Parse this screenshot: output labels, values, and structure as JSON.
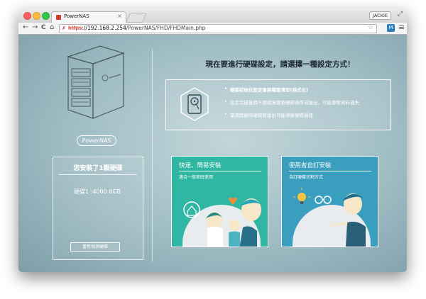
{
  "browser": {
    "tab_title": "PowerNAS",
    "tab_close": "×",
    "user_badge": "JACKIE",
    "url_protocol": "https",
    "url_host": "://192.168.2.254",
    "url_path": "/PowerNAS/FHD/FHDMain.php",
    "nav_back": "←",
    "nav_forward": "→",
    "nav_reload": "C",
    "nav_home": "⌂",
    "star": "☆",
    "menu": "≡",
    "ext_label": "M",
    "fullscreen": "⤢"
  },
  "sidebar": {
    "brand": "PowerNAS",
    "disk_panel_title": "您安裝了1顆硬碟",
    "disks": [
      "硬碟1 :4000.8GB"
    ],
    "rescan_button": "重新偵測硬碟"
  },
  "main": {
    "title": "現在要進行硬碟設定，請選擇一種設定方式！",
    "notices": [
      "硬碟初始化設定會將檔案清空(格式化)",
      "設定完成後請不要隨意變更硬碟順序或拔出，可能導致資料遺失",
      "電源開啟時硬碟將拔出可能導致硬碟損毀"
    ],
    "options": [
      {
        "title": "快速、簡易安裝",
        "subtitle": "適合一般家庭使用"
      },
      {
        "title": "使用者自訂安裝",
        "subtitle": "自訂硬碟切割方式"
      }
    ]
  },
  "colors": {
    "quick_card": "#2fb7a3",
    "custom_card": "#3a9fbe",
    "page_bg": "#a9c4ca"
  }
}
